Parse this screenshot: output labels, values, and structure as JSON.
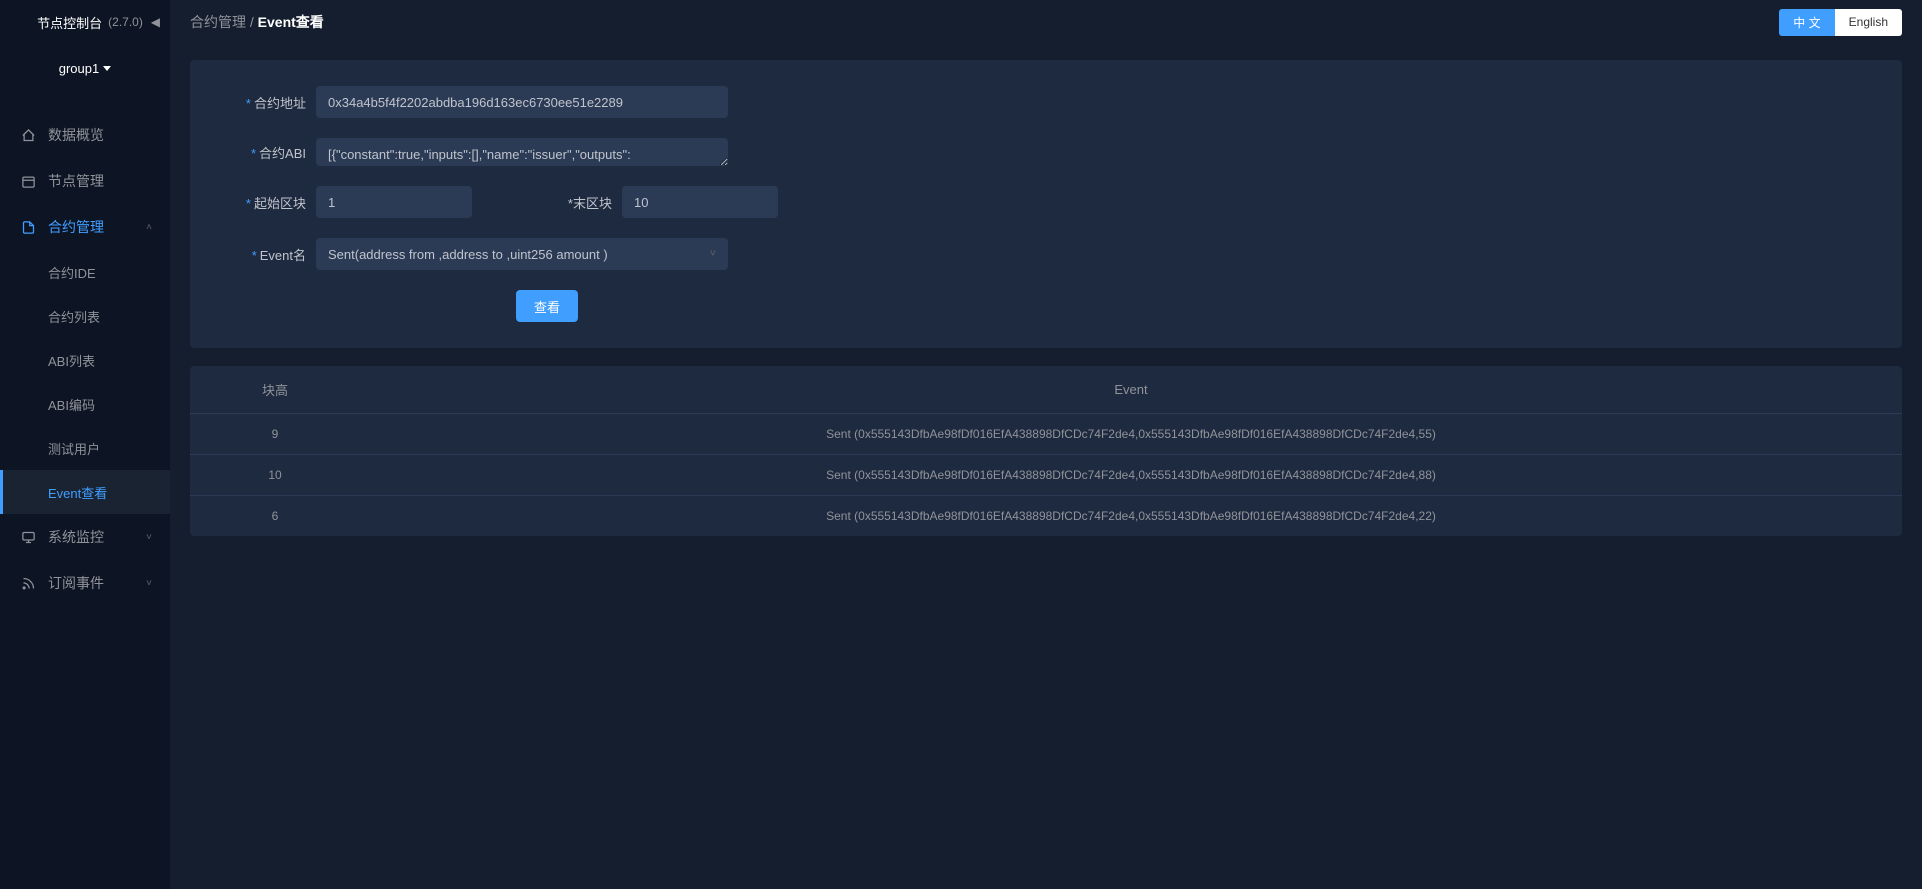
{
  "header": {
    "title": "节点控制台",
    "version": "(2.7.0)"
  },
  "group": {
    "selected": "group1"
  },
  "nav": {
    "overview": "数据概览",
    "nodeMgmt": "节点管理",
    "contractMgmt": "合约管理",
    "contractIDE": "合约IDE",
    "contractList": "合约列表",
    "abiList": "ABI列表",
    "abiEncode": "ABI编码",
    "testUser": "测试用户",
    "eventView": "Event查看",
    "sysMonitor": "系统监控",
    "subscribe": "订阅事件"
  },
  "breadcrumb": {
    "parent": "合约管理",
    "current": "Event查看"
  },
  "lang": {
    "zh": "中 文",
    "en": "English"
  },
  "form": {
    "addrLabel": "合约地址",
    "addrValue": "0x34a4b5f4f2202abdba196d163ec6730ee51e2289",
    "abiLabel": "合约ABI",
    "abiValue": "[{\"constant\":true,\"inputs\":[],\"name\":\"issuer\",\"outputs\":",
    "startBlockLabel": "起始区块",
    "startBlockValue": "1",
    "endBlockLabel": "末区块",
    "endBlockValue": "10",
    "eventNameLabel": "Event名",
    "eventNameValue": "Sent(address from ,address to ,uint256 amount )",
    "submit": "查看"
  },
  "table": {
    "headers": {
      "blockHeight": "块高",
      "event": "Event"
    },
    "rows": [
      {
        "h": "9",
        "e": "Sent (0x555143DfbAe98fDf016EfA438898DfCDc74F2de4,0x555143DfbAe98fDf016EfA438898DfCDc74F2de4,55)"
      },
      {
        "h": "10",
        "e": "Sent (0x555143DfbAe98fDf016EfA438898DfCDc74F2de4,0x555143DfbAe98fDf016EfA438898DfCDc74F2de4,88)"
      },
      {
        "h": "6",
        "e": "Sent (0x555143DfbAe98fDf016EfA438898DfCDc74F2de4,0x555143DfbAe98fDf016EfA438898DfCDc74F2de4,22)"
      }
    ]
  }
}
